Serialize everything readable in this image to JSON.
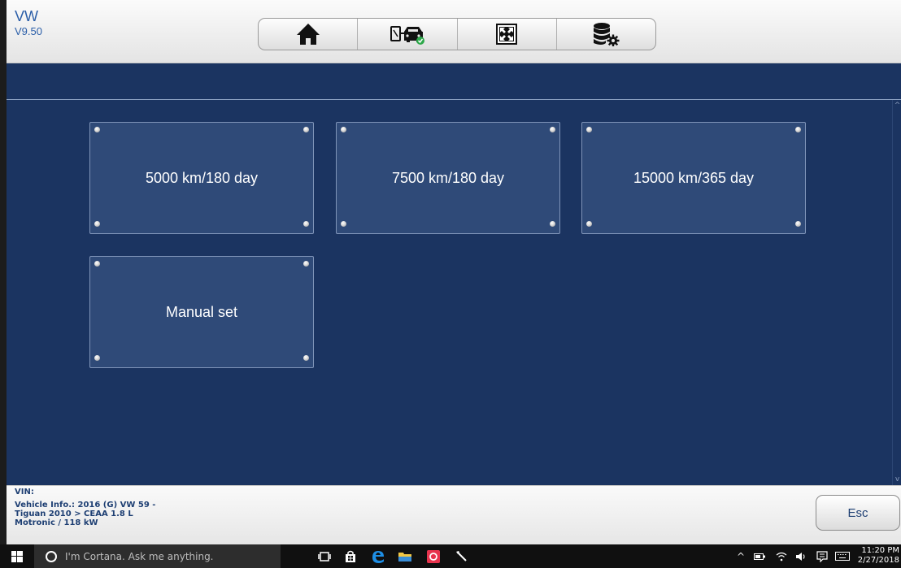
{
  "header": {
    "brand": "VW",
    "version": "V9.50"
  },
  "toolbar": {
    "icons": [
      "home-icon",
      "vehicle-connection-icon",
      "fullscreen-icon",
      "database-settings-icon"
    ]
  },
  "tiles": [
    {
      "label": "5000 km/180 day"
    },
    {
      "label": "7500 km/180 day"
    },
    {
      "label": "15000 km/365 day"
    },
    {
      "label": "Manual set"
    }
  ],
  "footer": {
    "vin_label": "VIN:",
    "vehicle_info": "Vehicle Info.: 2016 (G) VW 59 -\nTiguan 2010 > CEAA 1.8 L\nMotronic / 118 kW",
    "esc_label": "Esc"
  },
  "taskbar": {
    "cortana_placeholder": "I'm Cortana. Ask me anything.",
    "time": "11:20 PM",
    "date": "2/27/2018"
  },
  "colors": {
    "panel_blue": "#1b3461",
    "tile_blue": "#2f4a78",
    "brand_text": "#2b5ea8"
  }
}
